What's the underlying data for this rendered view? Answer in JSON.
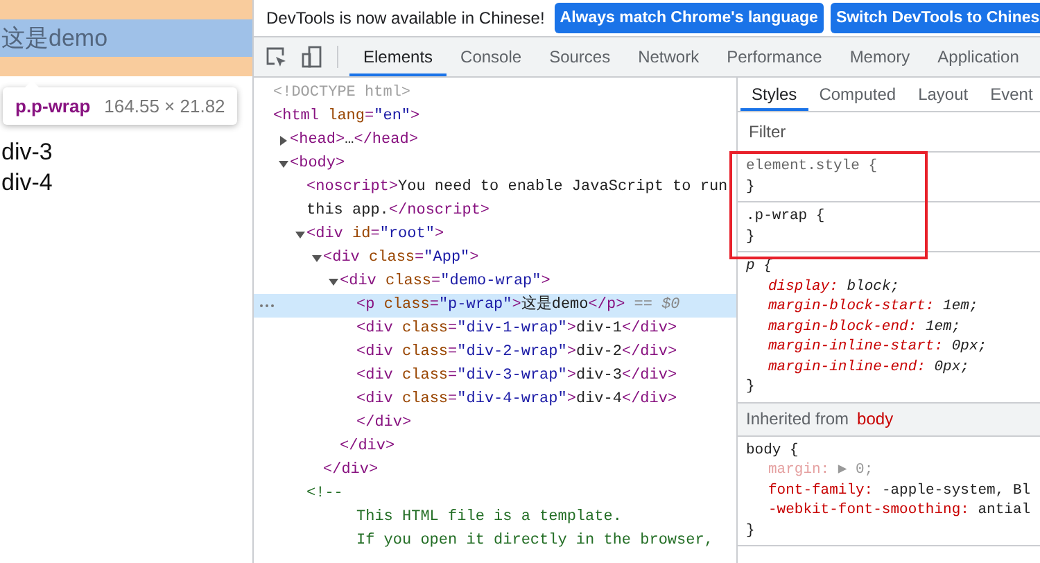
{
  "page": {
    "paragraph": "这是demo",
    "divs": [
      "div-3",
      "div-4"
    ],
    "tooltip": {
      "selector": "p.p-wrap",
      "size": "164.55 × 21.82"
    }
  },
  "banner": {
    "message": "DevTools is now available in Chinese!",
    "buttons": [
      "Always match Chrome's language",
      "Switch DevTools to Chines"
    ]
  },
  "tabs": [
    {
      "label": "Elements",
      "selected": true
    },
    {
      "label": "Console",
      "selected": false
    },
    {
      "label": "Sources",
      "selected": false
    },
    {
      "label": "Network",
      "selected": false
    },
    {
      "label": "Performance",
      "selected": false
    },
    {
      "label": "Memory",
      "selected": false
    },
    {
      "label": "Application",
      "selected": false
    }
  ],
  "dom_tree": [
    {
      "selected": false,
      "tokens": [
        {
          "kind": "doctype",
          "text": "<!DOCTYPE html>"
        }
      ]
    },
    {
      "selected": false,
      "tokens": [
        {
          "kind": "tag",
          "text": "<html "
        },
        {
          "kind": "attr",
          "text": "lang"
        },
        {
          "kind": "tag",
          "text": "="
        },
        {
          "kind": "value",
          "text": "\"en\""
        },
        {
          "kind": "tag",
          "text": ">"
        }
      ],
      "children": [
        {
          "selected": false,
          "expanded": false,
          "tokens": [
            {
              "kind": "tag",
              "text": "<head>"
            },
            {
              "kind": "text",
              "text": "…"
            },
            {
              "kind": "tag",
              "text": "</head>"
            }
          ]
        },
        {
          "selected": false,
          "expanded": true,
          "tokens": [
            {
              "kind": "tag",
              "text": "<body>"
            }
          ],
          "children": [
            {
              "selected": false,
              "tokens": [
                {
                  "kind": "tag",
                  "text": "<noscript>"
                },
                {
                  "kind": "text",
                  "text": "You need to enable JavaScript to run this app."
                },
                {
                  "kind": "tag",
                  "text": "</noscript>"
                }
              ]
            },
            {
              "selected": false,
              "expanded": true,
              "tokens": [
                {
                  "kind": "tag",
                  "text": "<div "
                },
                {
                  "kind": "attr",
                  "text": "id"
                },
                {
                  "kind": "tag",
                  "text": "="
                },
                {
                  "kind": "value",
                  "text": "\"root\""
                },
                {
                  "kind": "tag",
                  "text": ">"
                }
              ],
              "children": [
                {
                  "selected": false,
                  "expanded": true,
                  "tokens": [
                    {
                      "kind": "tag",
                      "text": "<div "
                    },
                    {
                      "kind": "attr",
                      "text": "class"
                    },
                    {
                      "kind": "tag",
                      "text": "="
                    },
                    {
                      "kind": "value",
                      "text": "\"App\""
                    },
                    {
                      "kind": "tag",
                      "text": ">"
                    }
                  ],
                  "children": [
                    {
                      "selected": false,
                      "expanded": true,
                      "tokens": [
                        {
                          "kind": "tag",
                          "text": "<div "
                        },
                        {
                          "kind": "attr",
                          "text": "class"
                        },
                        {
                          "kind": "tag",
                          "text": "="
                        },
                        {
                          "kind": "value",
                          "text": "\"demo-wrap\""
                        },
                        {
                          "kind": "tag",
                          "text": ">"
                        }
                      ],
                      "children": [
                        {
                          "selected": true,
                          "tokens": [
                            {
                              "kind": "tag",
                              "text": "<p "
                            },
                            {
                              "kind": "attr",
                              "text": "class"
                            },
                            {
                              "kind": "tag",
                              "text": "="
                            },
                            {
                              "kind": "value",
                              "text": "\"p-wrap\""
                            },
                            {
                              "kind": "tag",
                              "text": ">"
                            },
                            {
                              "kind": "text",
                              "text": "这是demo"
                            },
                            {
                              "kind": "tag",
                              "text": "</p>"
                            },
                            {
                              "kind": "ref",
                              "text": " == $0"
                            }
                          ]
                        },
                        {
                          "selected": false,
                          "tokens": [
                            {
                              "kind": "tag",
                              "text": "<div "
                            },
                            {
                              "kind": "attr",
                              "text": "class"
                            },
                            {
                              "kind": "tag",
                              "text": "="
                            },
                            {
                              "kind": "value",
                              "text": "\"div-1-wrap\""
                            },
                            {
                              "kind": "tag",
                              "text": ">"
                            },
                            {
                              "kind": "text",
                              "text": "div-1"
                            },
                            {
                              "kind": "tag",
                              "text": "</div>"
                            }
                          ]
                        },
                        {
                          "selected": false,
                          "tokens": [
                            {
                              "kind": "tag",
                              "text": "<div "
                            },
                            {
                              "kind": "attr",
                              "text": "class"
                            },
                            {
                              "kind": "tag",
                              "text": "="
                            },
                            {
                              "kind": "value",
                              "text": "\"div-2-wrap\""
                            },
                            {
                              "kind": "tag",
                              "text": ">"
                            },
                            {
                              "kind": "text",
                              "text": "div-2"
                            },
                            {
                              "kind": "tag",
                              "text": "</div>"
                            }
                          ]
                        },
                        {
                          "selected": false,
                          "tokens": [
                            {
                              "kind": "tag",
                              "text": "<div "
                            },
                            {
                              "kind": "attr",
                              "text": "class"
                            },
                            {
                              "kind": "tag",
                              "text": "="
                            },
                            {
                              "kind": "value",
                              "text": "\"div-3-wrap\""
                            },
                            {
                              "kind": "tag",
                              "text": ">"
                            },
                            {
                              "kind": "text",
                              "text": "div-3"
                            },
                            {
                              "kind": "tag",
                              "text": "</div>"
                            }
                          ]
                        },
                        {
                          "selected": false,
                          "tokens": [
                            {
                              "kind": "tag",
                              "text": "<div "
                            },
                            {
                              "kind": "attr",
                              "text": "class"
                            },
                            {
                              "kind": "tag",
                              "text": "="
                            },
                            {
                              "kind": "value",
                              "text": "\"div-4-wrap\""
                            },
                            {
                              "kind": "tag",
                              "text": ">"
                            },
                            {
                              "kind": "text",
                              "text": "div-4"
                            },
                            {
                              "kind": "tag",
                              "text": "</div>"
                            }
                          ]
                        },
                        {
                          "selected": false,
                          "tokens": [
                            {
                              "kind": "tag",
                              "text": "</div>"
                            }
                          ]
                        }
                      ]
                    },
                    {
                      "selected": false,
                      "tokens": [
                        {
                          "kind": "tag",
                          "text": "</div>"
                        }
                      ]
                    }
                  ]
                },
                {
                  "selected": false,
                  "tokens": [
                    {
                      "kind": "tag",
                      "text": "</div>"
                    }
                  ]
                }
              ]
            },
            {
              "selected": false,
              "tokens": [
                {
                  "kind": "comment",
                  "text": "<!--"
                }
              ],
              "children": [
                {
                  "selected": false,
                  "tokens": [
                    {
                      "kind": "comment",
                      "text": "This HTML file is a template."
                    }
                  ]
                },
                {
                  "selected": false,
                  "tokens": [
                    {
                      "kind": "comment",
                      "text": "If you open it directly in the browser,"
                    }
                  ]
                }
              ]
            }
          ]
        }
      ]
    }
  ],
  "styles_tabs": [
    {
      "label": "Styles",
      "selected": true
    },
    {
      "label": "Computed",
      "selected": false
    },
    {
      "label": "Layout",
      "selected": false
    },
    {
      "label": "Event",
      "selected": false
    }
  ],
  "filter": {
    "placeholder": "Filter"
  },
  "sections": [
    {
      "kind": "inline",
      "selector": "element.style {",
      "close": "}"
    },
    {
      "kind": "author",
      "selector": ".p-wrap {",
      "close": "}"
    },
    {
      "kind": "user-agent",
      "selector": "p {",
      "close": "}",
      "declarations": [
        {
          "prop": "display:",
          "value": "block;",
          "overridden": false
        },
        {
          "prop": "margin-block-start:",
          "value": "1em;",
          "overridden": false
        },
        {
          "prop": "margin-block-end:",
          "value": "1em;",
          "overridden": false
        },
        {
          "prop": "margin-inline-start:",
          "value": "0px;",
          "overridden": false
        },
        {
          "prop": "margin-inline-end:",
          "value": "0px;",
          "overridden": false
        }
      ]
    },
    {
      "kind": "inherited",
      "label": "Inherited from",
      "source": "body"
    },
    {
      "kind": "author",
      "selector": "body {",
      "close": "}",
      "declarations": [
        {
          "prop": "margin:",
          "value": "▶ 0;",
          "overridden": true
        },
        {
          "prop": "font-family:",
          "value": "-apple-system, Bl",
          "overridden": false
        },
        {
          "prop": "-webkit-font-smoothing:",
          "value": "antial",
          "overridden": false
        }
      ]
    }
  ]
}
